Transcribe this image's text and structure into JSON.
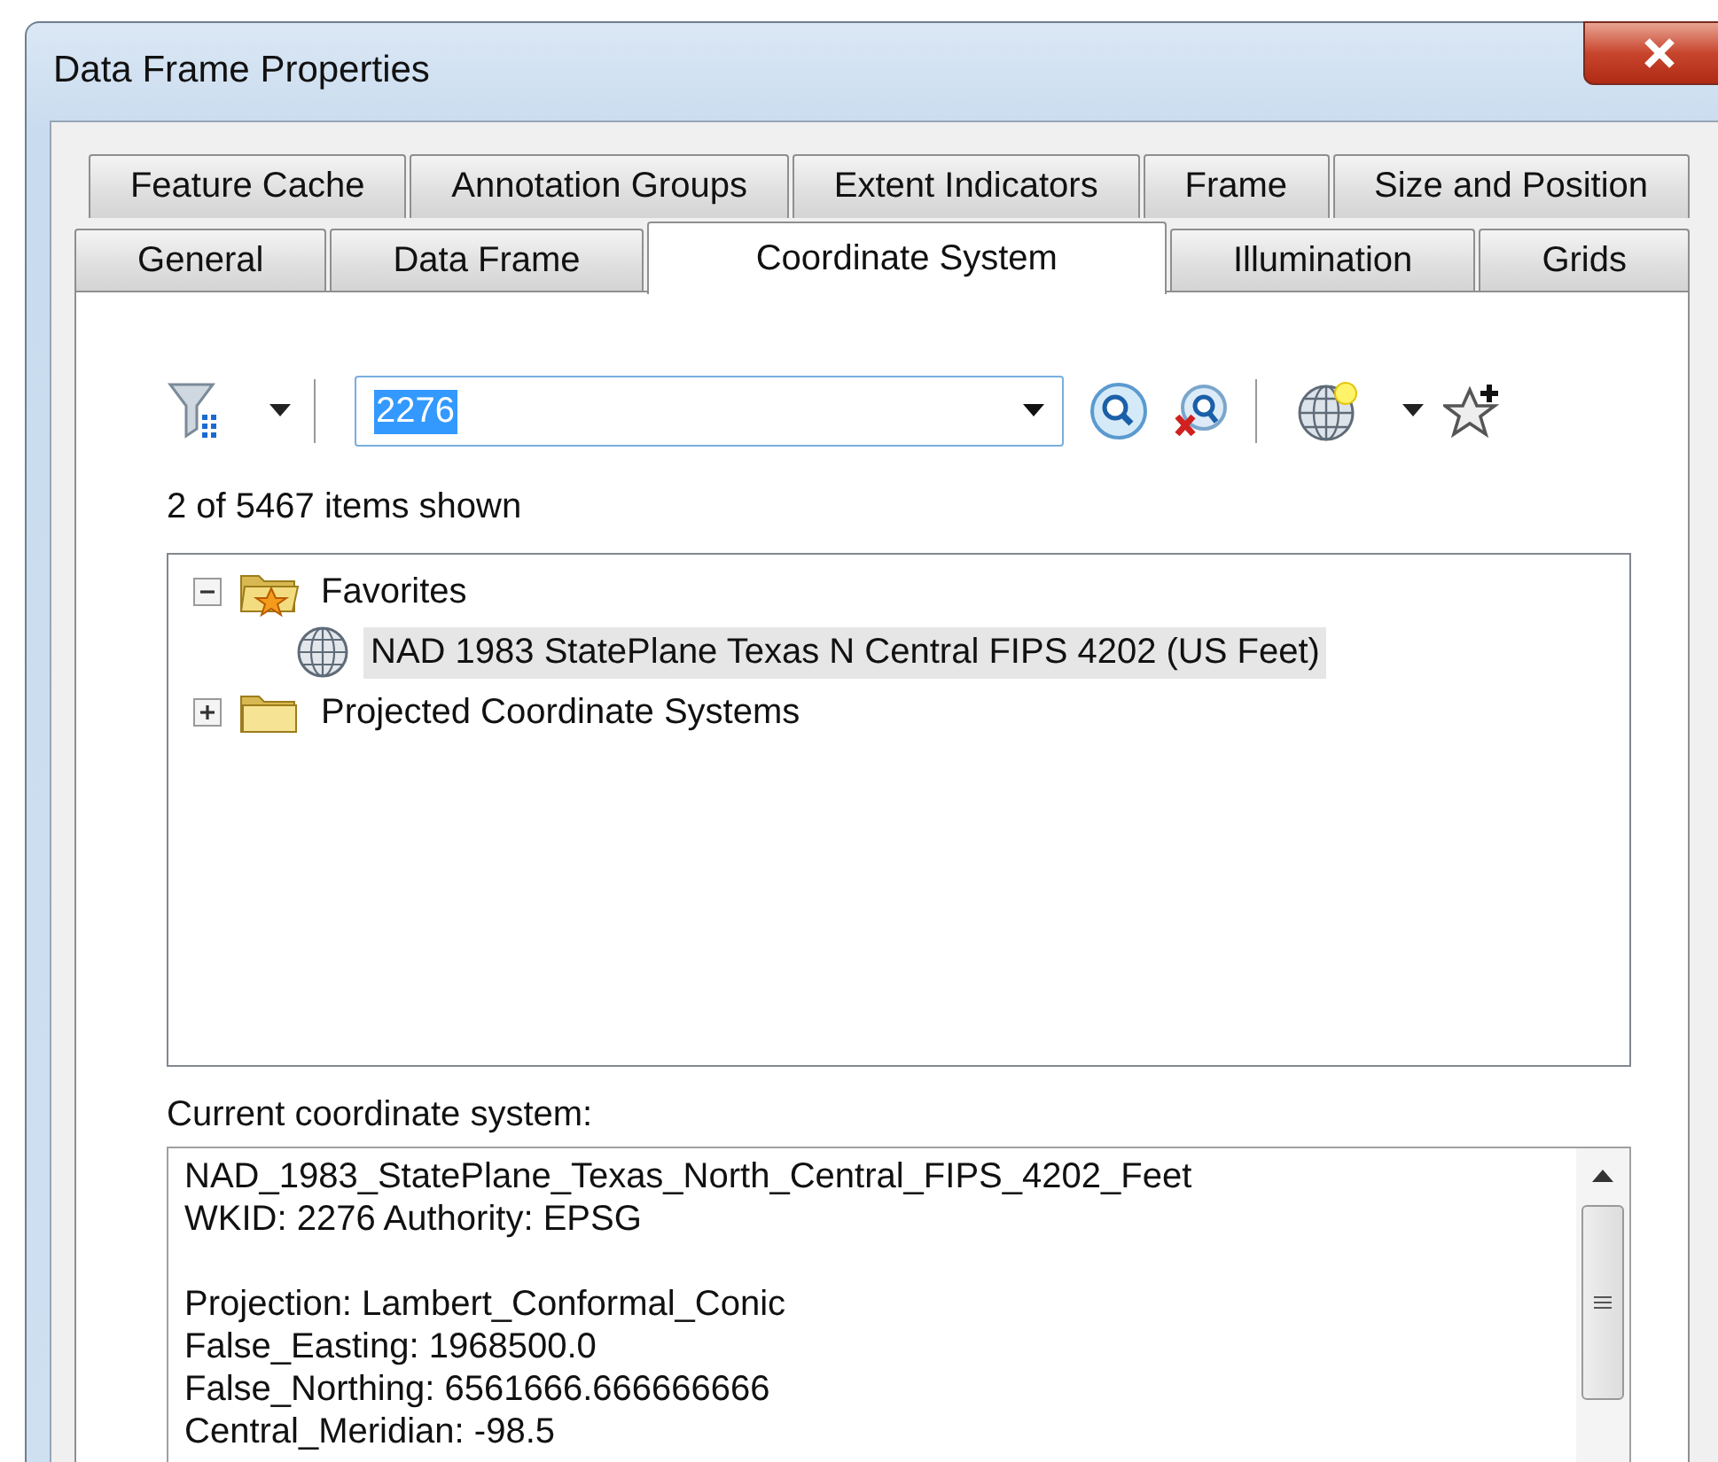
{
  "window": {
    "title": "Data Frame Properties"
  },
  "tab_rows": [
    [
      {
        "label": "Feature Cache",
        "selected": false
      },
      {
        "label": "Annotation Groups",
        "selected": false
      },
      {
        "label": "Extent Indicators",
        "selected": false
      },
      {
        "label": "Frame",
        "selected": false
      },
      {
        "label": "Size and Position",
        "selected": false
      }
    ],
    [
      {
        "label": "General",
        "selected": false
      },
      {
        "label": "Data Frame",
        "selected": false
      },
      {
        "label": "Coordinate System",
        "selected": true
      },
      {
        "label": "Illumination",
        "selected": false
      },
      {
        "label": "Grids",
        "selected": false
      }
    ]
  ],
  "search": {
    "value": "2276",
    "highlighted": true
  },
  "items_shown": "2 of 5467 items shown",
  "tree": [
    {
      "label": "Favorites",
      "kind": "folder_star",
      "expanded": true,
      "selected": false,
      "children": [
        {
          "label": "NAD 1983 StatePlane Texas N Central FIPS 4202 (US Feet)",
          "kind": "globe",
          "selected": true
        }
      ]
    },
    {
      "label": "Projected Coordinate Systems",
      "kind": "folder",
      "expanded": false,
      "selected": false
    }
  ],
  "current": {
    "label": "Current coordinate system:",
    "paragraphs": [
      [
        "NAD_1983_StatePlane_Texas_North_Central_FIPS_4202_Feet",
        "WKID: 2276 Authority: EPSG"
      ],
      [
        "Projection: Lambert_Conformal_Conic",
        "False_Easting: 1968500.0",
        "False_Northing: 6561666.666666666",
        "Central_Meridian: -98.5"
      ]
    ]
  }
}
